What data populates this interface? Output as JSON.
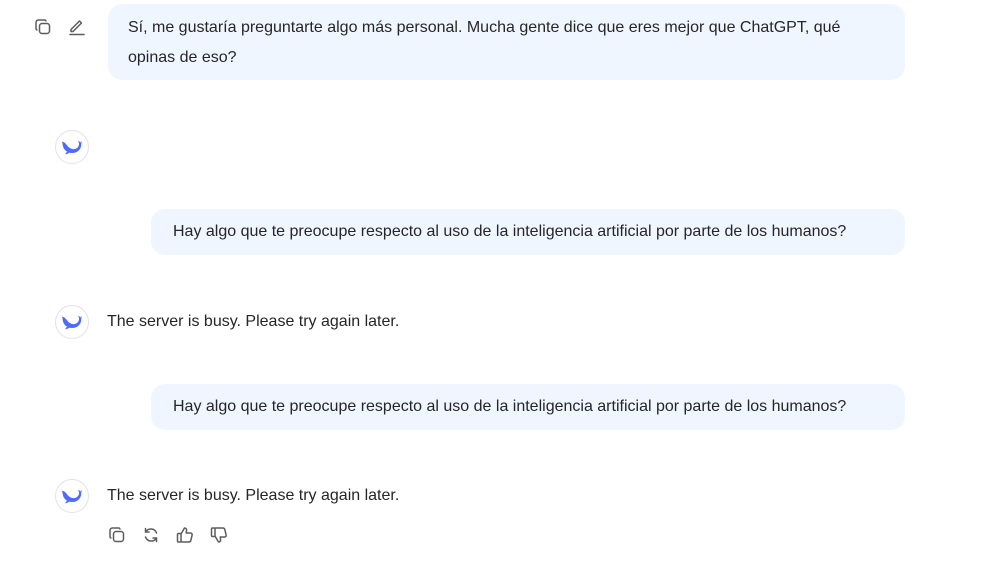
{
  "conversation": {
    "messages": [
      {
        "role": "user",
        "text": "Sí, me gustaría preguntarte algo más personal. Mucha gente dice que eres mejor que ChatGPT, qué opinas de eso?",
        "actions": [
          "copy-icon",
          "edit-icon"
        ]
      },
      {
        "role": "assistant",
        "text": ""
      },
      {
        "role": "user",
        "text": "Hay algo que te preocupe respecto al uso de la inteligencia artificial por parte de los humanos?"
      },
      {
        "role": "assistant",
        "text": "The server is busy. Please try again later."
      },
      {
        "role": "user",
        "text": "Hay algo que te preocupe respecto al uso de la inteligencia artificial por parte de los humanos?"
      },
      {
        "role": "assistant",
        "text": "The server is busy. Please try again later.",
        "actions": [
          "copy-icon",
          "regenerate-icon",
          "thumbs-up-icon",
          "thumbs-down-icon"
        ]
      }
    ]
  },
  "colors": {
    "user_bubble": "#eff6ff",
    "brand_logo": "#4d6bfe",
    "text": "#262626",
    "icon": "#5c5c5c"
  }
}
